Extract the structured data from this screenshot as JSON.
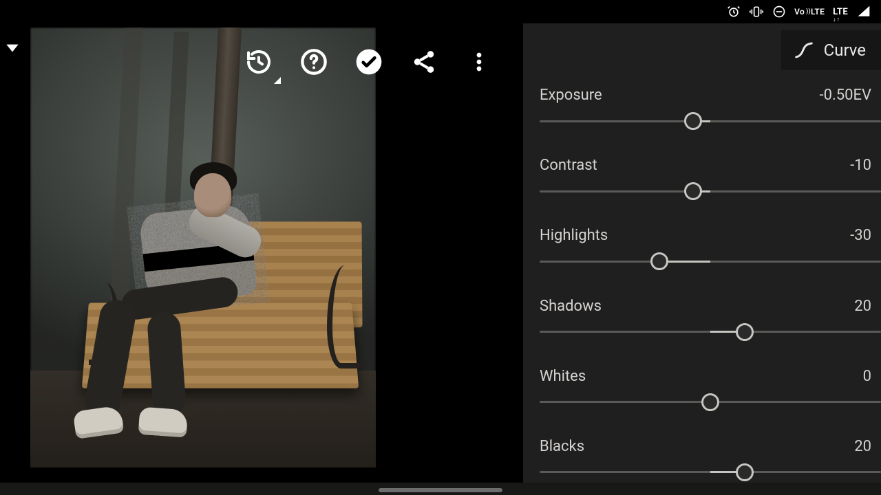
{
  "status_bar": {
    "icons": {
      "alarm": "alarm-icon",
      "vibrate": "vibrate-icon",
      "dnd": "do-not-disturb-icon",
      "volte": "Vo))\nLTE",
      "lte": "LTE",
      "signal": "signal-icon"
    }
  },
  "toolbar": {
    "dropdown": "panel-dropdown",
    "history": "history-icon",
    "help": "help-icon",
    "confirm": "confirm-icon",
    "share": "share-icon",
    "overflow": "more-icon"
  },
  "panel": {
    "header_button": "Curve"
  },
  "sliders": [
    {
      "label": "Exposure",
      "value_text": "-0.50EV",
      "min": -5,
      "max": 5,
      "value": -0.5,
      "center": 0
    },
    {
      "label": "Contrast",
      "value_text": "-10",
      "min": -100,
      "max": 100,
      "value": -10,
      "center": 0
    },
    {
      "label": "Highlights",
      "value_text": "-30",
      "min": -100,
      "max": 100,
      "value": -30,
      "center": 0
    },
    {
      "label": "Shadows",
      "value_text": "20",
      "min": -100,
      "max": 100,
      "value": 20,
      "center": 0
    },
    {
      "label": "Whites",
      "value_text": "0",
      "min": -100,
      "max": 100,
      "value": 0,
      "center": 0
    },
    {
      "label": "Blacks",
      "value_text": "20",
      "min": -100,
      "max": 100,
      "value": 20,
      "center": 0
    }
  ]
}
